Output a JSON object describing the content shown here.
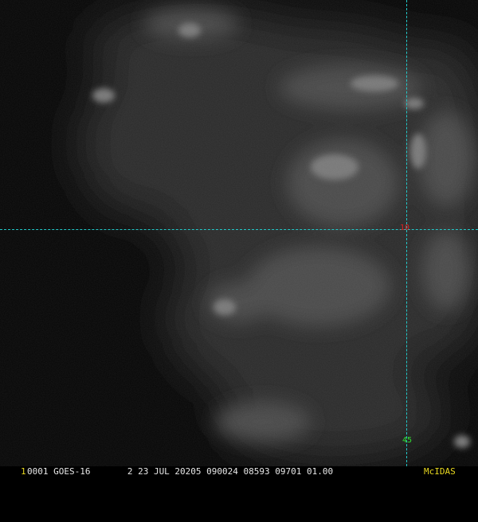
{
  "image": {
    "subject": "satellite-cloud-imagery",
    "palette": [
      "#050505",
      "#1a1a1a",
      "#3a3a3a",
      "#6a6a6a"
    ]
  },
  "gridlines": {
    "color": "#22c8c8",
    "latitude_label": "10",
    "latitude_label_color": "#e02020",
    "longitude_label": "45",
    "longitude_label_color": "#30e030"
  },
  "status_bar": {
    "frame_number": "1",
    "frame_number_color": "#e8d820",
    "info_text": "0001 GOES-16       2 23 JUL 20205 090024 08593 09701 01.00",
    "info_color": "#e8e8e8",
    "brand": "McIDAS",
    "brand_color": "#e8d820"
  }
}
